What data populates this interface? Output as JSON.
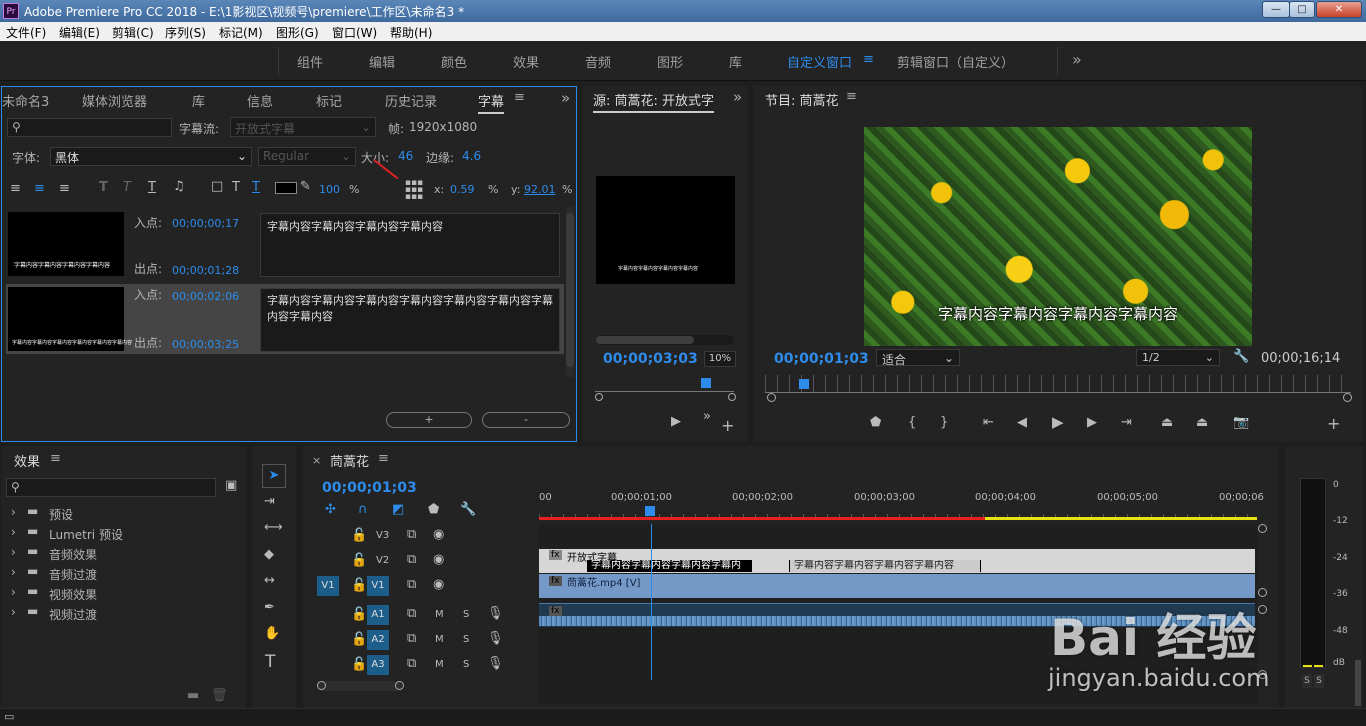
{
  "window": {
    "title": "Adobe Premiere Pro CC 2018 - E:\\1影视区\\视频号\\premiere\\工作区\\未命名3 *",
    "app_icon": "Pr",
    "min": "—",
    "max": "□",
    "close": "✕"
  },
  "menu": [
    "文件(F)",
    "编辑(E)",
    "剪辑(C)",
    "序列(S)",
    "标记(M)",
    "图形(G)",
    "窗口(W)",
    "帮助(H)"
  ],
  "workspaces": [
    "组件",
    "编辑",
    "颜色",
    "效果",
    "音频",
    "图形",
    "库",
    "自定义窗口",
    "剪辑窗口（自定义）"
  ],
  "workspace_active": "自定义窗口",
  "more": "»",
  "left_tabs": [
    "未命名3",
    "媒体浏览器",
    "库",
    "信息",
    "标记",
    "历史记录",
    "字幕"
  ],
  "captions": {
    "search_placeholder": "",
    "stream_label": "字幕流:",
    "stream_value": "开放式字幕",
    "frame_label": "帧:",
    "frame_value": "1920x1080",
    "font_label": "字体:",
    "font_value": "黑体",
    "style_value": "Regular",
    "size_label": "大小:",
    "size_value": "46",
    "edge_label": "边缘:",
    "edge_value": "4.6",
    "opacity": "100",
    "pct": "%",
    "x_label": "x:",
    "x_value": "0.59",
    "y_label": "y:",
    "y_value": "92.01",
    "items": [
      {
        "in_label": "入点:",
        "in": "00;00;00;17",
        "out_label": "出点:",
        "out": "00;00;01;28",
        "text": "字幕内容字幕内容字幕内容字幕内容",
        "thumb_text": "字幕内容字幕内容字幕内容字幕内容"
      },
      {
        "in_label": "入点:",
        "in": "00;00;02;06",
        "out_label": "出点:",
        "out": "00;00;03;25",
        "text": "字幕内容字幕内容字幕内容字幕内容字幕内容字幕内容字幕内容字幕内容",
        "thumb_text": "字幕内容字幕内容字幕内容字幕内容字幕内容字幕内容"
      }
    ],
    "add": "+",
    "remove": "-"
  },
  "source": {
    "title": "源: 茼蒿花: 开放式字",
    "timecode": "00;00;03;03",
    "zoom": "10%",
    "thumb_text": "字幕内容字幕内容字幕内容字幕内容"
  },
  "program": {
    "title": "节目: 茼蒿花",
    "subtitle": "字幕内容字幕内容字幕内容字幕内容",
    "timecode": "00;00;01;03",
    "fit": "适合",
    "res": "1/2",
    "duration": "00;00;16;14"
  },
  "effects": {
    "title": "效果",
    "items": [
      "预设",
      "Lumetri 预设",
      "音频效果",
      "音频过渡",
      "视频效果",
      "视频过渡"
    ]
  },
  "timeline": {
    "title": "茼蒿花",
    "timecode": "00;00;01;03",
    "ruler": [
      "00",
      "00;00;01;00",
      "00;00;02;00",
      "00;00;03;00",
      "00;00;04;00",
      "00;00;05;00",
      "00;00;06"
    ],
    "tracks_v": [
      "V3",
      "V2",
      "V1"
    ],
    "tracks_a": [
      "A1",
      "A2",
      "A3"
    ],
    "src_v": "V1",
    "caption_track": "开放式字幕",
    "cap_clip1": "字幕内容字幕内容字幕内容字幕内",
    "cap_clip2": "字幕内容字幕内容字幕内容字幕内容",
    "video_clip": "茼蒿花.mp4 [V]",
    "fx": "fx",
    "m": "M",
    "s": "S"
  },
  "meter": {
    "scale": [
      "0",
      "-12",
      "-24",
      "-36",
      "-48",
      "dB"
    ],
    "s1": "S",
    "s2": "S"
  },
  "watermark": {
    "brand": "Bai 经验",
    "url": "jingyan.baidu.com"
  }
}
